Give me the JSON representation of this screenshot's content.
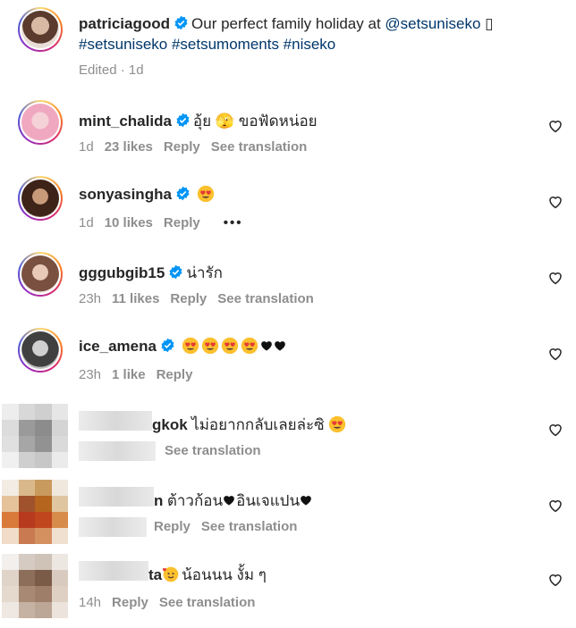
{
  "caption": {
    "username": "patriciagood",
    "text_pre": "Our perfect family holiday at ",
    "mention": "@setsuniseko",
    "hashtags": "#setsuniseko #setsumoments #niseko",
    "edited": "Edited · 1d"
  },
  "comments": [
    {
      "username": "mint_chalida",
      "text": "อุ้ย 🫣 ขอฟัดหน่อย",
      "time": "1d",
      "likes": "23 likes",
      "reply": "Reply",
      "translate": "See translation"
    },
    {
      "username": "sonyasingha",
      "time": "1d",
      "likes": "10 likes",
      "reply": "Reply",
      "more": "•••"
    },
    {
      "username": "gggubgib15",
      "text": "น่ารัก",
      "time": "23h",
      "likes": "11 likes",
      "reply": "Reply",
      "translate": "See translation"
    },
    {
      "username": "ice_amena",
      "time": "23h",
      "likes": "1 like",
      "reply": "Reply"
    },
    {
      "username": "gkok",
      "text": "ไม่อยากกลับเลยล่ะซิ",
      "translate": "See translation"
    },
    {
      "username": "n",
      "text_a": "ต้าวก้อน",
      "text_b": "อินเจแปน",
      "reply": "Reply",
      "translate": "See translation"
    },
    {
      "username": "ta",
      "text": "น้อนนน งั้ม ๆ",
      "time": "14h",
      "reply": "Reply",
      "translate": "See translation"
    }
  ],
  "colors": {
    "username": "#262626",
    "meta": "#8e8e8e",
    "mention": "#00376b",
    "verified": "#0095f6"
  }
}
